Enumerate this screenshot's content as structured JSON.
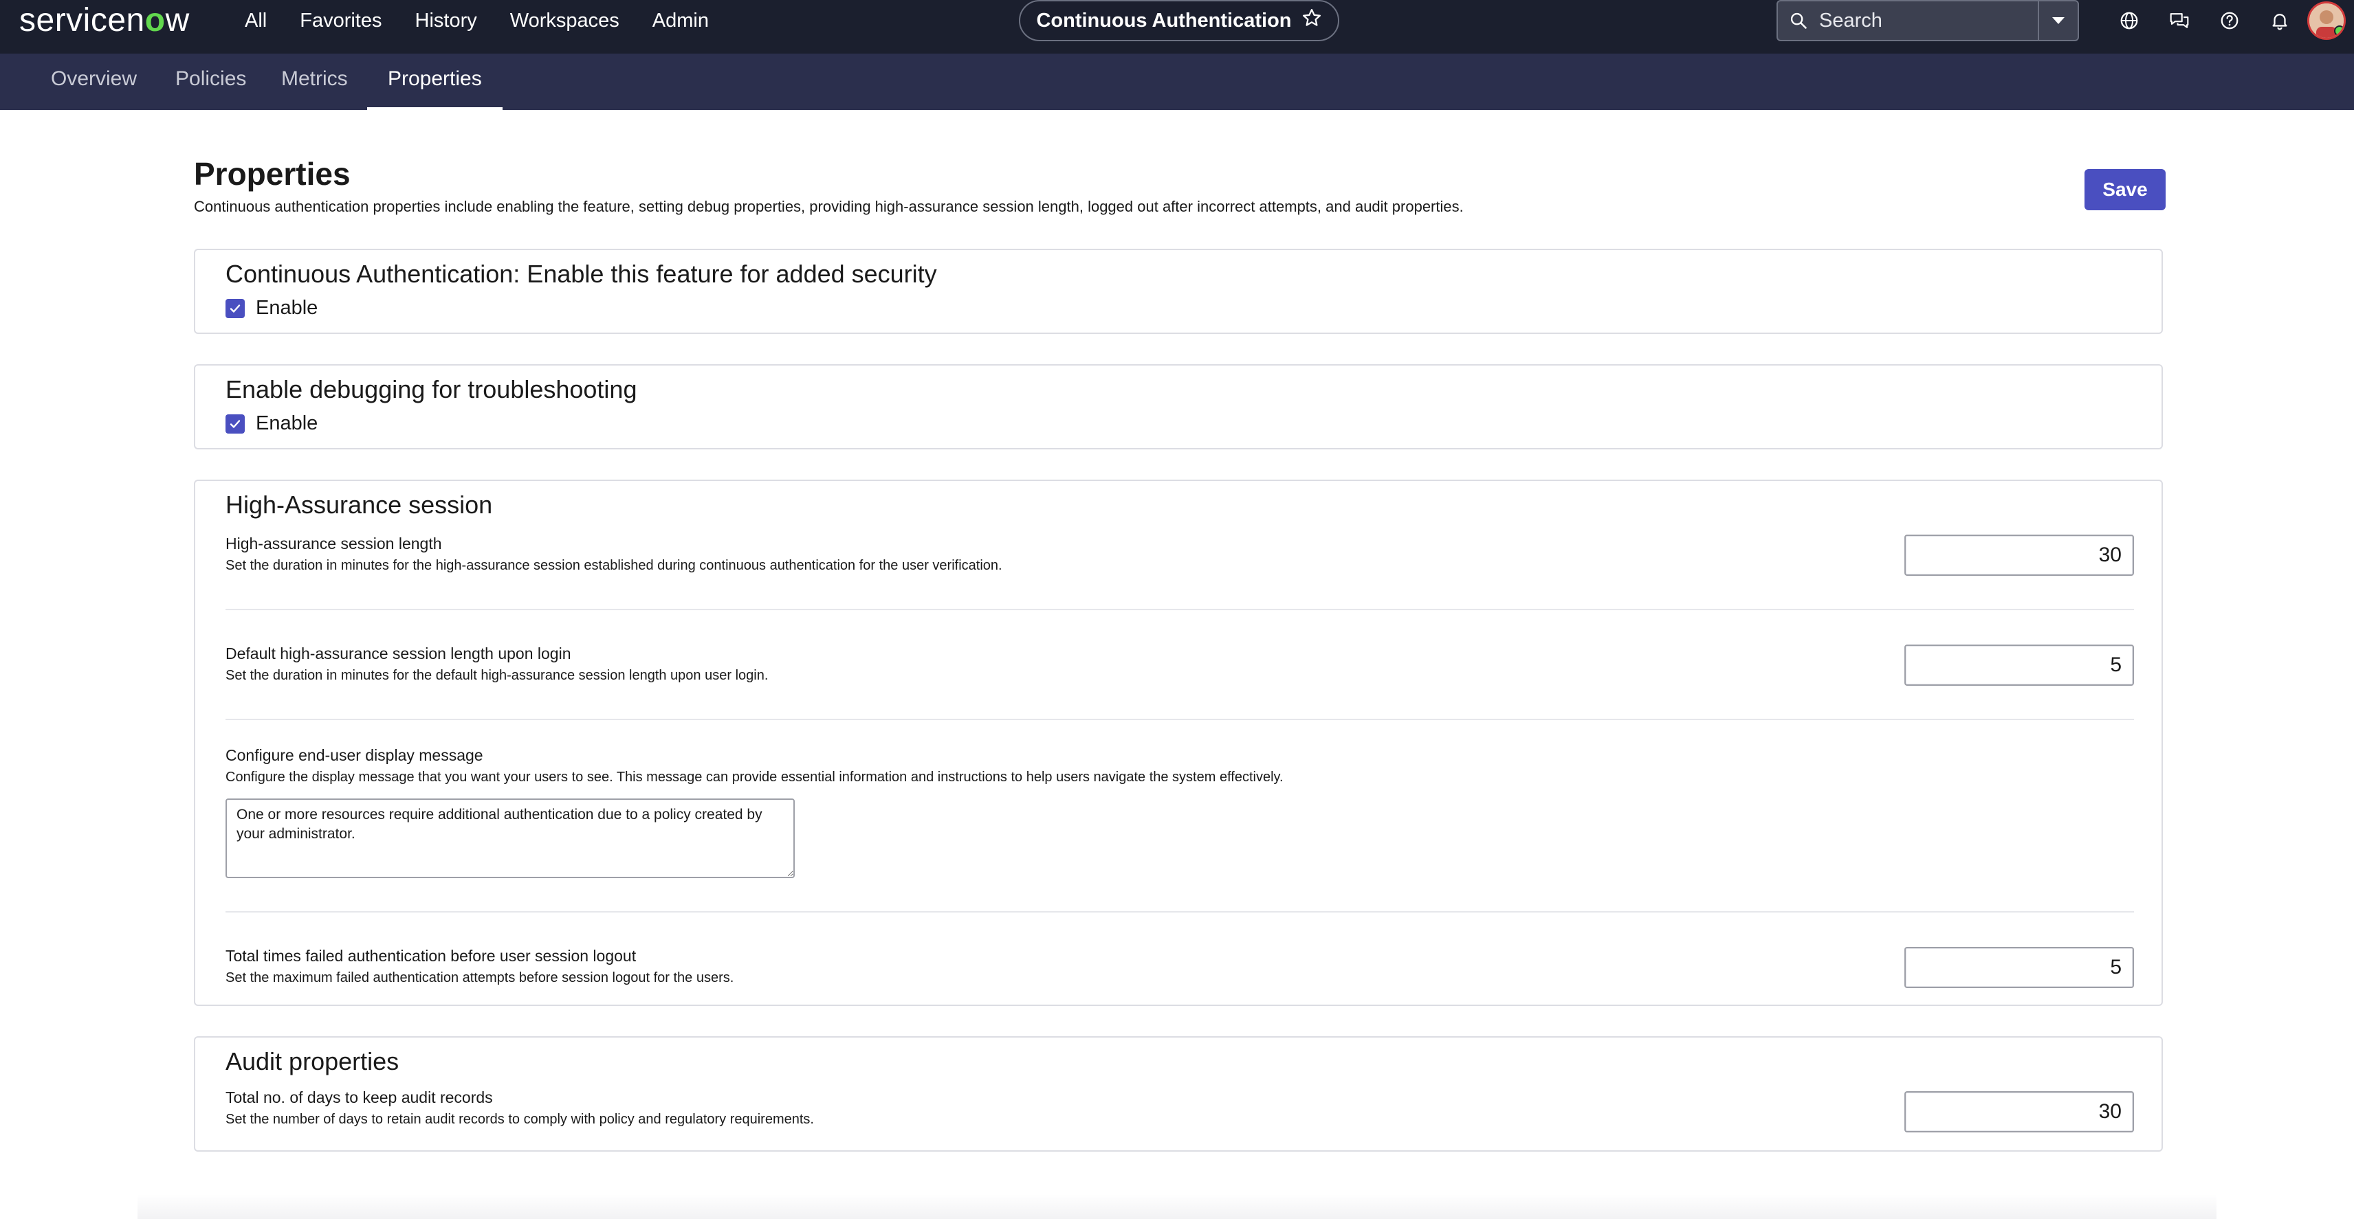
{
  "app": {
    "logo": {
      "part1": "servicen",
      "part2": "o",
      "part3": "w"
    },
    "main_nav": [
      {
        "label": "All"
      },
      {
        "label": "Favorites"
      },
      {
        "label": "History"
      },
      {
        "label": "Workspaces"
      },
      {
        "label": "Admin"
      }
    ],
    "context_title": "Continuous Authentication",
    "search": {
      "placeholder": "Search"
    },
    "icons": [
      "globe-icon",
      "chat-icon",
      "help-icon",
      "bell-icon"
    ],
    "accent_color": "#4a4fc0",
    "brand_green": "#62d84e"
  },
  "tabs": [
    {
      "label": "Overview"
    },
    {
      "label": "Policies"
    },
    {
      "label": "Metrics"
    },
    {
      "label": "Properties",
      "active": true
    }
  ],
  "page": {
    "title": "Properties",
    "description": "Continuous authentication properties include enabling the feature, setting debug properties, providing high-assurance session length, logged out after incorrect attempts, and audit properties.",
    "save_label": "Save"
  },
  "sections": {
    "continuous_auth": {
      "title": "Continuous Authentication: Enable this feature for added security",
      "checkbox_label": "Enable",
      "checked": true
    },
    "debugging": {
      "title": "Enable debugging for troubleshooting",
      "checkbox_label": "Enable",
      "checked": true
    },
    "high_assurance": {
      "title": "High-Assurance session",
      "session_length": {
        "label": "High-assurance session length",
        "help": "Set the duration in minutes for the high-assurance session established during continuous authentication for the user verification.",
        "value": "30"
      },
      "default_length": {
        "label": "Default high-assurance session length upon login",
        "help": "Set the duration in minutes for the default high-assurance session length upon user login.",
        "value": "5"
      },
      "display_message": {
        "label": "Configure end-user display message",
        "help": "Configure the display message that you want your users to see. This message can provide essential information and instructions to help users navigate the system effectively.",
        "value": "One or more resources require additional authentication due to a policy created by your administrator."
      },
      "failed_attempts": {
        "label": "Total times failed authentication before user session logout",
        "help": "Set the maximum failed authentication attempts before session logout for the users.",
        "value": "5"
      }
    },
    "audit": {
      "title": "Audit properties",
      "retention": {
        "label": "Total no. of days to keep audit records",
        "help": "Set the number of days to retain audit records to comply with policy and regulatory requirements.",
        "value": "30"
      }
    }
  }
}
